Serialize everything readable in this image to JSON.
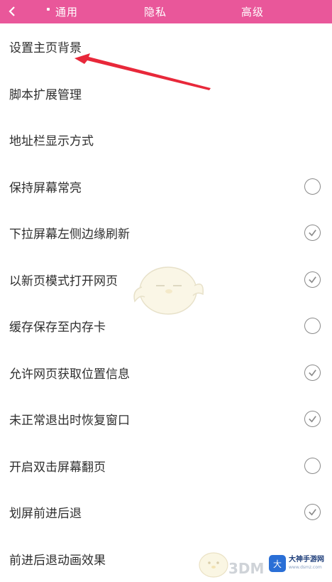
{
  "header": {
    "back_icon": "chevron-left-icon",
    "tabs": [
      "通用",
      "隐私",
      "高级"
    ],
    "bg_color": "#e9579a"
  },
  "settings": [
    {
      "label": "设置主页背景",
      "toggle": null
    },
    {
      "label": "脚本扩展管理",
      "toggle": null
    },
    {
      "label": "地址栏显示方式",
      "toggle": null
    },
    {
      "label": "保持屏幕常亮",
      "toggle": false
    },
    {
      "label": "下拉屏幕左侧边缘刷新",
      "toggle": true
    },
    {
      "label": "以新页模式打开网页",
      "toggle": true
    },
    {
      "label": "缓存保存至内存卡",
      "toggle": false
    },
    {
      "label": "允许网页获取位置信息",
      "toggle": true
    },
    {
      "label": "未正常退出时恢复窗口",
      "toggle": true
    },
    {
      "label": "开启双击屏幕翻页",
      "toggle": false
    },
    {
      "label": "划屏前进后退",
      "toggle": true
    },
    {
      "label": "前进后退动画效果",
      "toggle": null
    }
  ],
  "annotation": {
    "arrow_color": "#e8283a"
  },
  "watermark": {
    "text": "3DM",
    "badge_logo": "大",
    "badge_title": "大神手游网",
    "badge_sub": "www.dsmz.com"
  }
}
